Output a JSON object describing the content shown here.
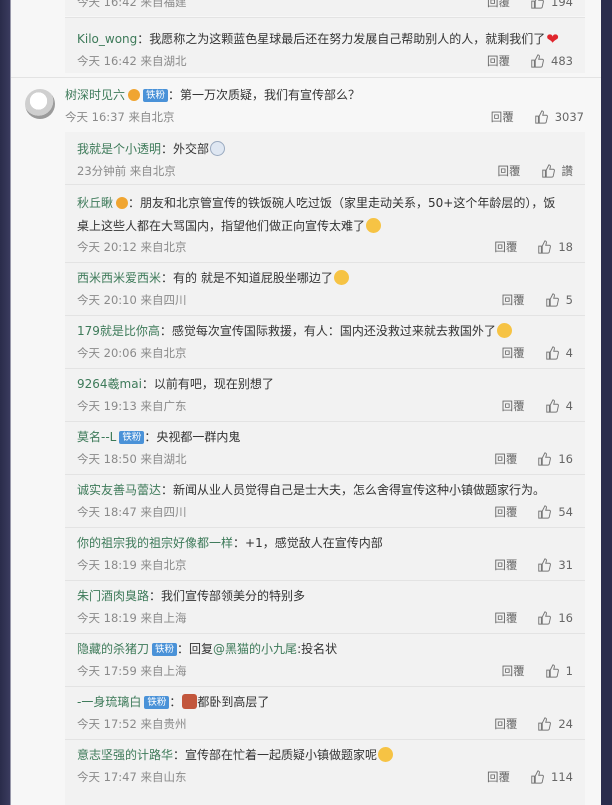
{
  "top_partial": {
    "meta": "今天 16:42 来自福建",
    "reply_label": "回覆",
    "likes": "194"
  },
  "kilo": {
    "user": "Kilo_wong",
    "text": "：我愿称之为这颗蓝色星球最后还在努力发展自己帮助别人的人，就剩我们了",
    "meta": "今天 16:42 来自湖北",
    "reply_label": "回覆",
    "likes": "483"
  },
  "main": {
    "user": "树深时见六",
    "badge": "铁粉",
    "text": "：第一万次质疑，我们有宣传部么？",
    "meta": "今天 16:37 来自北京",
    "reply_label": "回覆",
    "likes": "3037"
  },
  "replies": [
    {
      "user": "我就是个小透明",
      "badge": "",
      "text": "：外交部",
      "meta": "23分钟前 来自北京",
      "reply_label": "回覆",
      "likes": "讚"
    },
    {
      "user": "秋丘瞅",
      "badge": "",
      "text": "：朋友和北京管宣传的铁饭碗人吃过饭（家里走动关系，50+这个年龄层的），饭桌上这些人都在大骂国内，指望他们做正向宣传太难了",
      "meta": "今天 20:12 来自北京",
      "reply_label": "回覆",
      "likes": "18"
    },
    {
      "user": "西米西米爱西米",
      "badge": "",
      "text": "：有的 就是不知道屁股坐哪边了",
      "meta": "今天 20:10 来自四川",
      "reply_label": "回覆",
      "likes": "5"
    },
    {
      "user": "179就是比你高",
      "badge": "",
      "text": "：感觉每次宣传国际救援，有人：国内还没救过来就去救国外了",
      "meta": "今天 20:06 来自北京",
      "reply_label": "回覆",
      "likes": "4"
    },
    {
      "user": "9264羲mai",
      "badge": "",
      "text": "：以前有吧，现在别想了",
      "meta": "今天 19:13 来自广东",
      "reply_label": "回覆",
      "likes": "4"
    },
    {
      "user": "莫名--L",
      "badge": "铁粉",
      "text": "：央视都一群内鬼",
      "meta": "今天 18:50 来自湖北",
      "reply_label": "回覆",
      "likes": "16"
    },
    {
      "user": "诚实友善马蕾达",
      "badge": "",
      "text": "：新闻从业人员觉得自己是士大夫，怎么舍得宣传这种小镇做题家行为。",
      "meta": "今天 18:47 来自四川",
      "reply_label": "回覆",
      "likes": "54"
    },
    {
      "user": "你的祖宗我的祖宗好像都一样",
      "badge": "",
      "text": "：+1，感觉敌人在宣传内部",
      "meta": "今天 18:19 来自北京",
      "reply_label": "回覆",
      "likes": "31"
    },
    {
      "user": "朱门酒肉臭路",
      "badge": "",
      "text": "：我们宣传部领美分的特别多",
      "meta": "今天 18:19 来自上海",
      "reply_label": "回覆",
      "likes": "16"
    },
    {
      "user": "隐藏的杀猪刀",
      "badge": "铁粉",
      "text_prefix": "：回复",
      "mention": "@黑猫的小九尾",
      "text": ":投名状",
      "meta": "今天 17:59 来自上海",
      "reply_label": "回覆",
      "likes": "1"
    },
    {
      "user": "-一身琉璃白",
      "badge": "铁粉",
      "text": "都卧到高层了",
      "meta": "今天 17:52 来自贵州",
      "reply_label": "回覆",
      "likes": "24"
    },
    {
      "user": "意志坚强的计路华",
      "badge": "",
      "text": "：宣传部在忙着一起质疑小镇做题家呢",
      "meta": "今天 17:47 来自山东",
      "reply_label": "回覆",
      "likes": "114"
    }
  ],
  "colors": {
    "username": "#3d7a59",
    "badge": "#4a92d8",
    "background": "#f7f7f7"
  }
}
